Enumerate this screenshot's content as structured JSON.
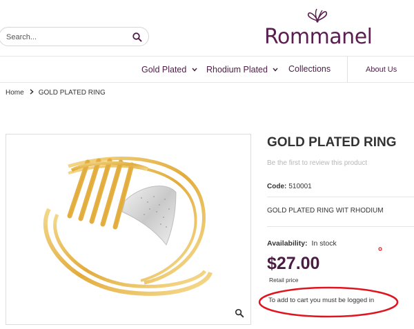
{
  "header": {
    "search": {
      "placeholder": "Search..."
    },
    "logo_text": "Rommanel"
  },
  "nav": {
    "items": [
      {
        "label": "Gold Plated",
        "has_dropdown": true
      },
      {
        "label": "Rhodium Plated",
        "has_dropdown": true
      },
      {
        "label": "Collections",
        "has_dropdown": false
      }
    ],
    "about": "About Us"
  },
  "breadcrumb": {
    "home": "Home",
    "current": "GOLD PLATED RING"
  },
  "product": {
    "title": "GOLD PLATED RING",
    "review_link": "Be the first to review this product",
    "code_label": "Code:",
    "code_value": "510001",
    "description": "GOLD PLATED RING WIT RHODIUM",
    "availability_label": "Availability:",
    "availability_value": "In stock",
    "price": "$27.00",
    "price_note": "Retail price",
    "cart_message": "To add to cart you must be logged in"
  },
  "colors": {
    "brand": "#5b1e50",
    "annotation": "#e0141e",
    "gold": "#e8b84a",
    "silver": "#d9d9d9"
  },
  "icons": {
    "search": "search-icon",
    "zoom": "zoom-icon",
    "logo": "butterfly-logo-icon",
    "chevron": "chevron-down-icon",
    "breadcrumb_separator": "chevron-right-icon"
  }
}
